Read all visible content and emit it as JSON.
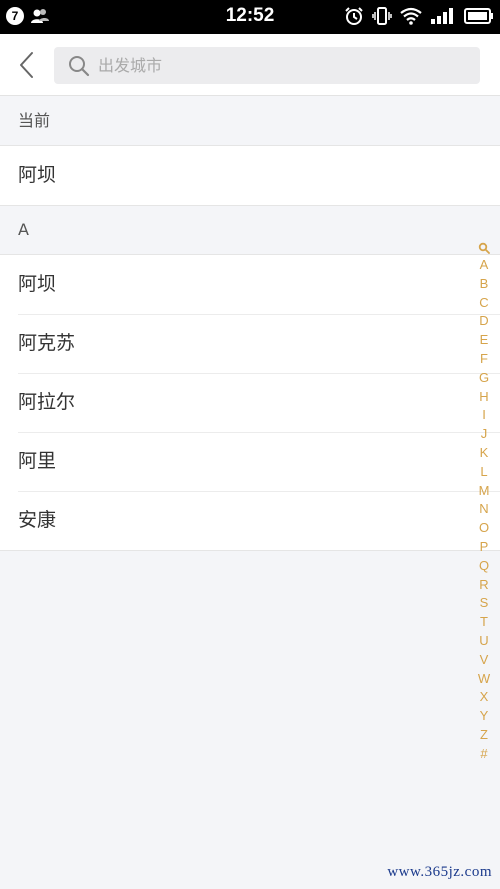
{
  "status_bar": {
    "badge": "7",
    "time": "12:52"
  },
  "header": {
    "search_placeholder": "出发城市"
  },
  "current_section": {
    "title": "当前",
    "items": [
      "阿坝"
    ]
  },
  "section_a": {
    "title": "A",
    "items": [
      "阿坝",
      "阿克苏",
      "阿拉尔",
      "阿里",
      "安康"
    ]
  },
  "index_bar": {
    "letters": [
      "A",
      "B",
      "C",
      "D",
      "E",
      "F",
      "G",
      "H",
      "I",
      "J",
      "K",
      "L",
      "M",
      "N",
      "O",
      "P",
      "Q",
      "R",
      "S",
      "T",
      "U",
      "V",
      "W",
      "X",
      "Y",
      "Z",
      "#"
    ]
  },
  "watermark": "www.365jz.com",
  "colors": {
    "accent": "#d6a44b",
    "background": "#f4f5f8"
  }
}
